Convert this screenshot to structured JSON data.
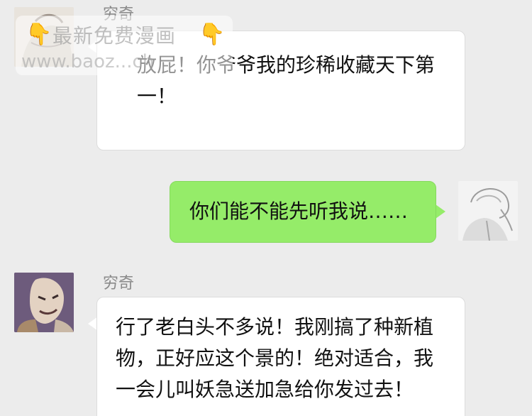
{
  "messages": [
    {
      "sender": "穷奇",
      "text": "放屁！你爷爷我的珍稀收藏天下第一！"
    },
    {
      "sender": "",
      "text": "你们能不能先听我说……"
    },
    {
      "sender": "穷奇",
      "text": "行了老白头不多说！我刚搞了种新植物，正好应这个景的！绝对适合，我一会儿叫妖急送加急给你发过去！"
    }
  ],
  "watermark": {
    "title": "最新免费漫画",
    "url": "www.baoz...ch",
    "hand_icon": "pointing-down-hand-icon"
  },
  "colors": {
    "background": "#ececec",
    "incoming_bubble": "#ffffff",
    "outgoing_bubble": "#95ec69",
    "sender_name": "#8a8a8a"
  }
}
